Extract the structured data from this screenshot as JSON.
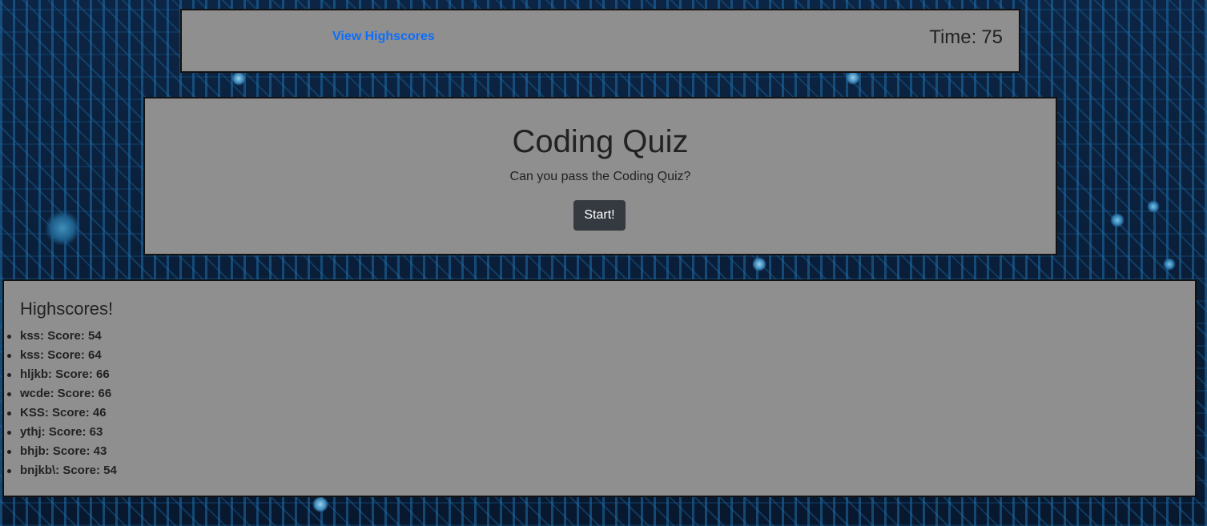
{
  "header": {
    "view_highscores_label": "View Highscores",
    "timer_label": "Time:",
    "timer_value": "75",
    "link_color": "#0d6efd"
  },
  "quiz": {
    "title": "Coding Quiz",
    "subtitle": "Can you pass the Coding Quiz?",
    "start_label": "Start!",
    "button_color": "#343a40"
  },
  "highscores": {
    "title": "Highscores!",
    "entries": [
      {
        "text": "kss: Score: 54"
      },
      {
        "text": "kss: Score: 64"
      },
      {
        "text": "hljkb: Score: 66"
      },
      {
        "text": "wcde: Score: 66"
      },
      {
        "text": "KSS: Score: 46"
      },
      {
        "text": "ythj: Score: 63"
      },
      {
        "text": "bhjb: Score: 43"
      },
      {
        "text": "bnjkb\\: Score: 54"
      }
    ]
  },
  "theme": {
    "panel_color": "#8f8f8f",
    "background": "circuit-board-image"
  }
}
